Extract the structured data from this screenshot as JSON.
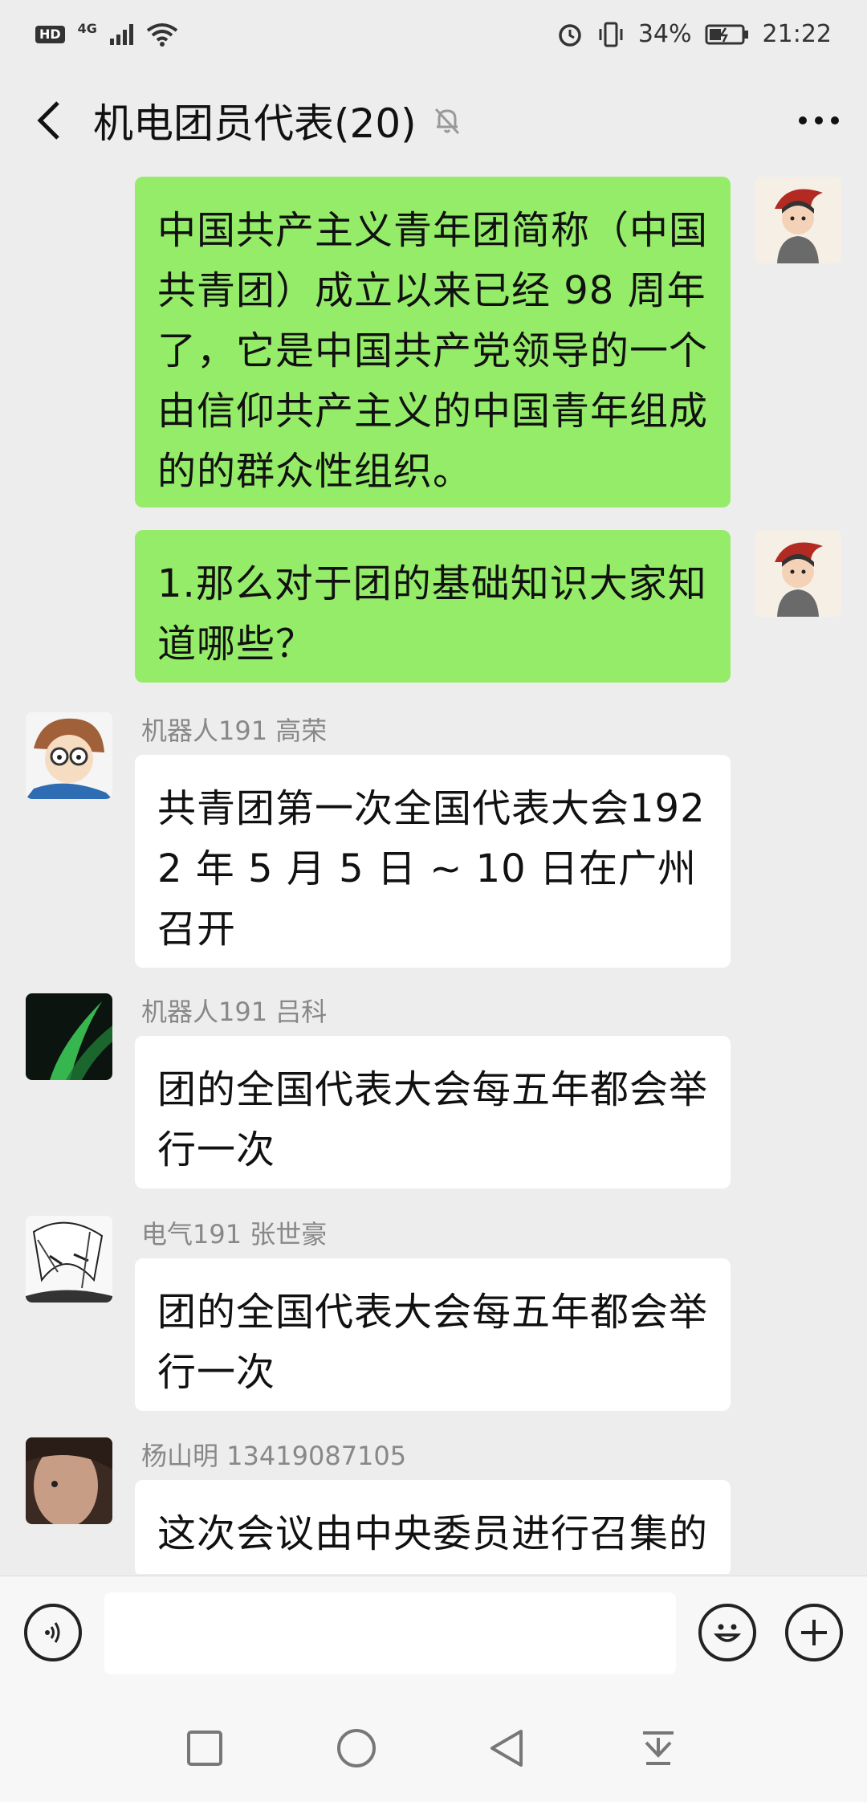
{
  "status_bar": {
    "hd": "HD",
    "network": "4G",
    "battery": "34%",
    "time": "21:22"
  },
  "header": {
    "title": "机电团员代表(20)",
    "back_icon": "chevron-left-icon",
    "mute_icon": "bell-muted-icon",
    "more_icon": "more-dots-icon"
  },
  "messages": [
    {
      "direction": "out",
      "text": "中国共产主义青年团简称（中国共青团）成立以来已经 98 周年了，它是中国共产党领导的一个由信仰共产主义的中国青年组成的的群众性组织。"
    },
    {
      "direction": "out",
      "text": "1.那么对于团的基础知识大家知道哪些？"
    },
    {
      "direction": "in",
      "sender": "机器人191 高荣",
      "text": "共青团第一次全国代表大会1922 年 5 月 5 日 ~ 10 日在广州召开"
    },
    {
      "direction": "in",
      "sender": "机器人191 吕科",
      "text": "团的全国代表大会每五年都会举行一次"
    },
    {
      "direction": "in",
      "sender": "电气191 张世豪",
      "text": "团的全国代表大会每五年都会举行一次"
    },
    {
      "direction": "in",
      "sender": "杨山明 13419087105",
      "text": "这次会议由中央委员进行召集的"
    }
  ],
  "input_bar": {
    "placeholder": "",
    "voice_icon": "voice-icon",
    "emoji_icon": "emoji-icon",
    "plus_icon": "plus-icon"
  },
  "nav_bar": {
    "icons": [
      "square-icon",
      "circle-icon",
      "triangle-back-icon",
      "download-icon"
    ]
  },
  "colors": {
    "background": "#ededed",
    "outgoing_bubble": "#95ec69",
    "incoming_bubble": "#ffffff",
    "sender_name": "#888888"
  }
}
